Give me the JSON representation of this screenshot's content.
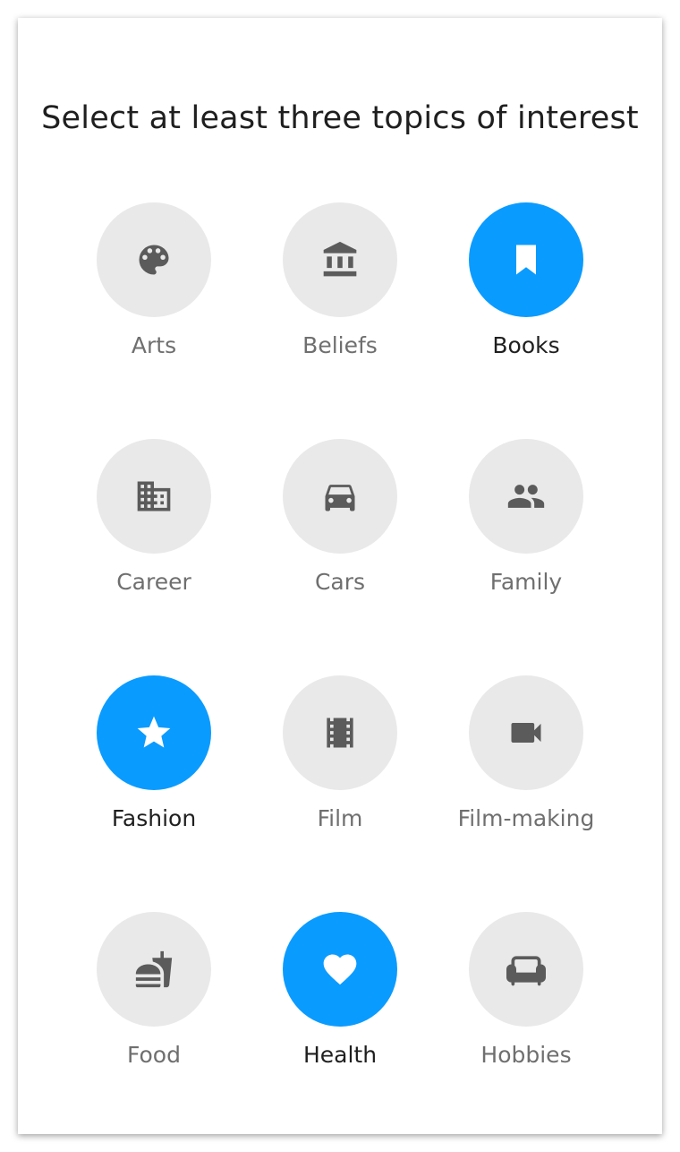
{
  "title": "Select at least three topics of interest",
  "colors": {
    "selected": "#0a9bff",
    "unselected": "#e9e9e9",
    "icon": "#5b5b5b",
    "label": "#6f6f6f",
    "label_selected": "#1f1f1f"
  },
  "topics": [
    {
      "label": "Arts",
      "icon": "palette-icon",
      "selected": false
    },
    {
      "label": "Beliefs",
      "icon": "bank-icon",
      "selected": false
    },
    {
      "label": "Books",
      "icon": "bookmark-icon",
      "selected": true
    },
    {
      "label": "Career",
      "icon": "building-icon",
      "selected": false
    },
    {
      "label": "Cars",
      "icon": "car-icon",
      "selected": false
    },
    {
      "label": "Family",
      "icon": "people-icon",
      "selected": false
    },
    {
      "label": "Fashion",
      "icon": "star-icon",
      "selected": true
    },
    {
      "label": "Film",
      "icon": "film-strip-icon",
      "selected": false
    },
    {
      "label": "Film-making",
      "icon": "video-camera-icon",
      "selected": false
    },
    {
      "label": "Food",
      "icon": "fastfood-icon",
      "selected": false
    },
    {
      "label": "Health",
      "icon": "heart-icon",
      "selected": true
    },
    {
      "label": "Hobbies",
      "icon": "sofa-icon",
      "selected": false
    }
  ]
}
